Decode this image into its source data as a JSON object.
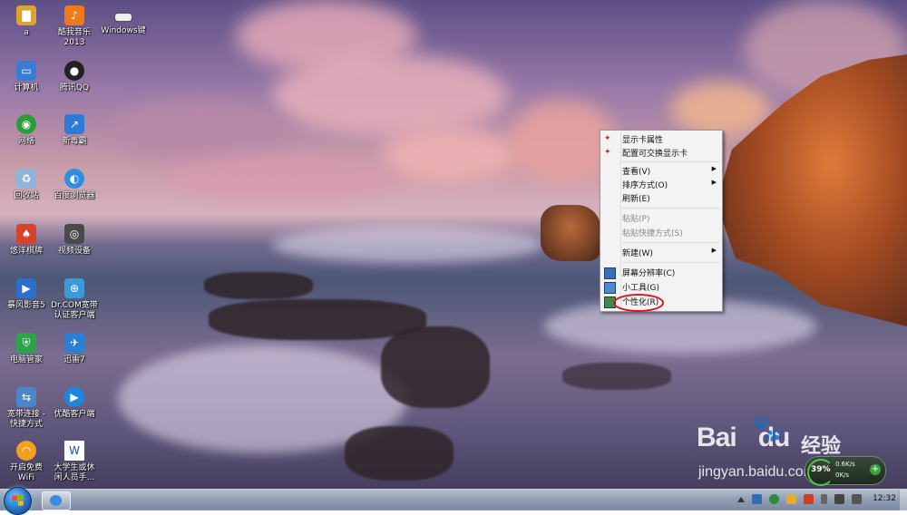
{
  "desktop_icons": [
    {
      "label": "a",
      "icon": "folder-icon",
      "color": "#d9a431"
    },
    {
      "label": "酷我音乐\n2013",
      "icon": "kuwo-music-icon",
      "color": "#f07a1a"
    },
    {
      "label": "Windows键",
      "icon": "keyboard-key-icon",
      "color": "#eeeeee"
    },
    {
      "label": "计算机",
      "icon": "computer-icon",
      "color": "#3a7bd5"
    },
    {
      "label": "腾讯QQ",
      "icon": "qq-penguin-icon",
      "color": "#222222"
    },
    {
      "label": "网络",
      "icon": "network-globe-icon",
      "color": "#2a9d3a"
    },
    {
      "label": "新毒霸",
      "icon": "duba-antivirus-icon",
      "color": "#2d7bd6"
    },
    {
      "label": "回收站",
      "icon": "recycle-bin-icon",
      "color": "#8fb6d8"
    },
    {
      "label": "百度浏览器",
      "icon": "baidu-browser-icon",
      "color": "#2f8ee0"
    },
    {
      "label": "悠洋棋牌",
      "icon": "card-game-icon",
      "color": "#d8422d"
    },
    {
      "label": "视频设备",
      "icon": "webcam-icon",
      "color": "#4a4a4a"
    },
    {
      "label": "暴风影音5",
      "icon": "storm-player-icon",
      "color": "#2a6fc9"
    },
    {
      "label": "Dr.COM宽带\n认证客户端",
      "icon": "drcom-client-icon",
      "color": "#3b9ad9"
    },
    {
      "label": "电脑管家",
      "icon": "pc-manager-shield-icon",
      "color": "#2fa34a"
    },
    {
      "label": "迅雷7",
      "icon": "thunder-icon",
      "color": "#2a7fd6"
    },
    {
      "label": "宽带连接 -\n快捷方式",
      "icon": "broadband-connection-icon",
      "color": "#4a86c8"
    },
    {
      "label": "优酷客户端",
      "icon": "youku-icon",
      "color": "#1f86e0"
    },
    {
      "label": "开启免费\nWiFi",
      "icon": "wifi-icon",
      "color": "#f0a020"
    },
    {
      "label": "大学生或休\n闲人员手...",
      "icon": "word-document-icon",
      "color": "#ffffff"
    }
  ],
  "context_menu": {
    "items": [
      {
        "label": "显示卡属性",
        "icon": "graphics-card-icon"
      },
      {
        "label": "配置可交换显示卡",
        "icon": "graphics-card-switch-icon"
      },
      {
        "label": "查看(V)",
        "submenu": true
      },
      {
        "label": "排序方式(O)",
        "submenu": true
      },
      {
        "label": "刷新(E)"
      },
      {
        "label": "粘贴(P)",
        "disabled": true
      },
      {
        "label": "粘贴快捷方式(S)",
        "disabled": true
      },
      {
        "label": "新建(W)",
        "submenu": true
      },
      {
        "label": "屏幕分辨率(C)",
        "icon": "screen-resolution-icon"
      },
      {
        "label": "小工具(G)",
        "icon": "gadgets-icon"
      },
      {
        "label": "个性化(R)",
        "icon": "personalize-icon",
        "highlighted": true
      }
    ],
    "submenu_arrow": "▶",
    "highlight_color": "#e0141e"
  },
  "speed_widget": {
    "percent": "39%",
    "upload": "0.6K/s",
    "download": "0K/s",
    "plus": "+"
  },
  "taskbar": {
    "clock": "12:32"
  },
  "watermark": {
    "logo": "Bai",
    "logo_du": "du",
    "paw": "🐾",
    "cn": "经验",
    "url": "jingyan.baidu.com"
  }
}
